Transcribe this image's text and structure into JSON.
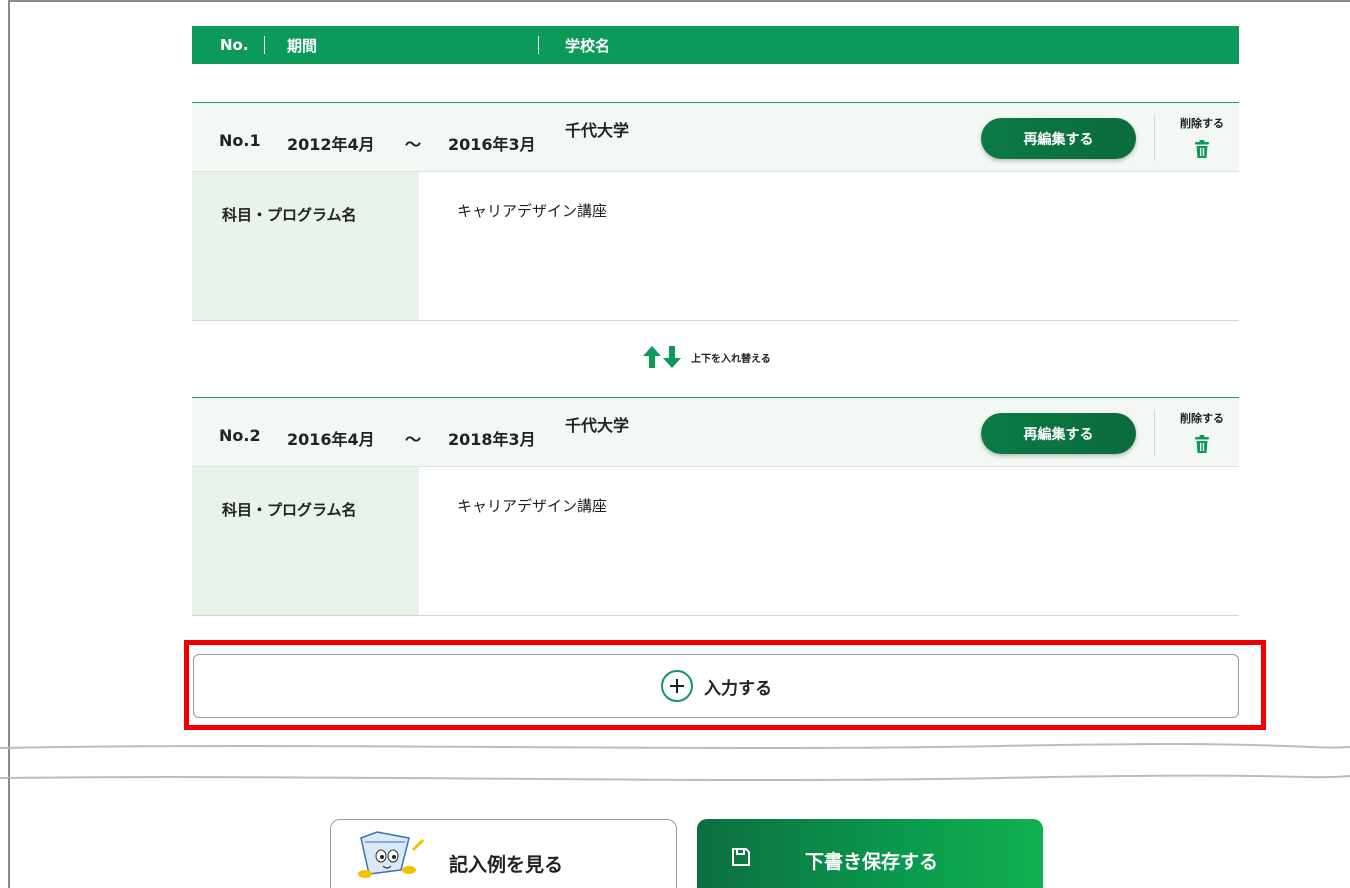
{
  "table_header": {
    "no": "No.",
    "period": "期間",
    "school": "学校名"
  },
  "entries": [
    {
      "no": "No.1",
      "start": "2012年4月",
      "tilde": "～",
      "end": "2016年3月",
      "school": "千代大学",
      "reedit_label": "再編集する",
      "delete_label": "削除する",
      "program_label": "科目・プログラム名",
      "program_value": "キャリアデザイン講座"
    },
    {
      "no": "No.2",
      "start": "2016年4月",
      "tilde": "～",
      "end": "2018年3月",
      "school": "千代大学",
      "reedit_label": "再編集する",
      "delete_label": "削除する",
      "program_label": "科目・プログラム名",
      "program_value": "キャリアデザイン講座"
    }
  ],
  "swap": {
    "label": "上下を入れ替える",
    "icon": "swap-arrows-icon"
  },
  "add": {
    "label": "入力する",
    "icon": "plus-circle-icon"
  },
  "footer": {
    "example_label": "記入例を見る",
    "save_label": "下書き保存する",
    "save_icon": "floppy-disk-icon",
    "example_icon": "mascot-illustration"
  },
  "colors": {
    "primary_green": "#0b9a5a",
    "highlight": "#ee0000",
    "label_bg": "#e8f3ea"
  }
}
